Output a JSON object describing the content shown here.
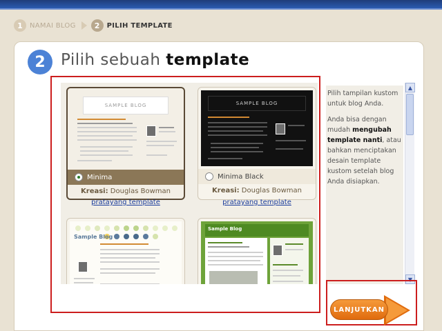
{
  "steps": [
    {
      "number": "1",
      "label": "NAMAI BLOG",
      "state": "inactive"
    },
    {
      "number": "2",
      "label": "PILIH TEMPLATE",
      "state": "active"
    }
  ],
  "heading": {
    "number": "2",
    "text_plain": "Pilih sebuah ",
    "text_bold": "template"
  },
  "templates": [
    {
      "name": "Minima",
      "designer_label": "Kreasi:",
      "designer": "Douglas Bowman",
      "preview_link": "pratayang template",
      "selected": true,
      "thumb_title": "SAMPLE BLOG"
    },
    {
      "name": "Minima Black",
      "designer_label": "Kreasi:",
      "designer": "Douglas Bowman",
      "preview_link": "pratayang template",
      "selected": false,
      "thumb_title": "SAMPLE BLOG"
    },
    {
      "thumb_title": "Sample Blog"
    },
    {
      "thumb_title": "Sample Blog"
    }
  ],
  "sidebar": {
    "p1": "Pilih tampilan kustom untuk blog Anda.",
    "p2_a": "Anda bisa dengan mudah ",
    "p2_bold": "mengubah template nanti",
    "p2_b": ", atau bahkan menciptakan desain template kustom setelah blog Anda disiapkan."
  },
  "continue_button": "LANJUTKAN",
  "colors": {
    "accent_blue": "#4c82d6",
    "highlight_red": "#cc1d1d",
    "button_orange": "#e06b0e"
  }
}
